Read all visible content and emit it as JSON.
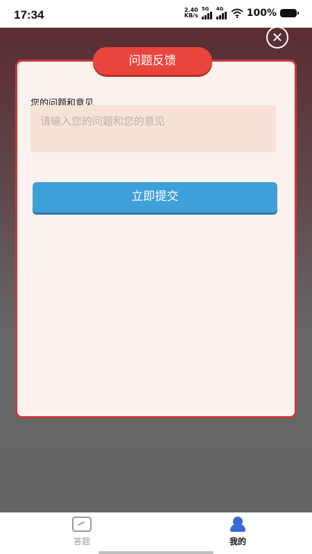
{
  "status_bar": {
    "time": "17:34",
    "net_speed_value": "2.40",
    "net_speed_unit": "KB/s",
    "signal1_tag": "5G",
    "signal2_tag": "4G",
    "battery": "100%"
  },
  "dialog": {
    "title": "问题反馈",
    "field_label": "您的问题和意见",
    "input_placeholder": "请输入您的问题和您的意见",
    "input_value": "",
    "submit_label": "立即提交"
  },
  "bottom_nav": {
    "items": [
      {
        "label": "答题",
        "icon": "answer-icon",
        "active": false
      },
      {
        "label": "我的",
        "icon": "user-icon",
        "active": true
      }
    ]
  },
  "colors": {
    "title_red": "#e9453c",
    "dialog_border": "#c9373b",
    "submit_blue": "#3f9fd8",
    "active_nav_blue": "#3b68d8"
  }
}
